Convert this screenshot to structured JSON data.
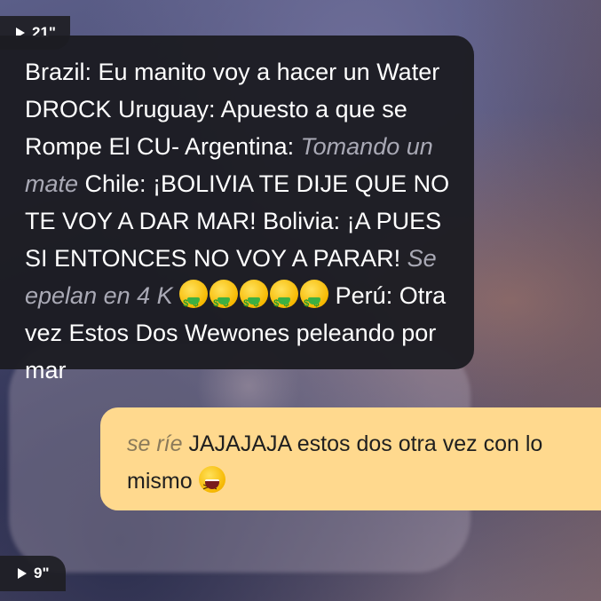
{
  "voice_messages": [
    {
      "duration": "21\""
    },
    {
      "duration": "9\""
    }
  ],
  "incoming_message": {
    "part1": "Brazil: Eu manito voy a hacer un Water DROCK  Uruguay: Apuesto a que se Rompe El CU- Argentina: ",
    "action1": "Tomando un mate",
    "part2": " Chile: ¡BOLIVIA TE DIJE QUE NO TE VOY A DAR MAR! Bolivia: ¡A PUES SI ENTONCES NO VOY A PARAR! ",
    "action2": "Se epelan en 4 K",
    "emoji": "money-mouth-face",
    "emoji_count": 5,
    "part3": " Perú: Otra vez Estos Dos Wewones peleando por mar"
  },
  "outgoing_message": {
    "action": "se ríe",
    "text": " JAJAJAJA estos dos otra vez con lo mismo ",
    "emoji": "grinning-squinting-face"
  },
  "colors": {
    "incoming_bubble": "#1c1c22",
    "outgoing_bubble": "#ffd98e"
  }
}
